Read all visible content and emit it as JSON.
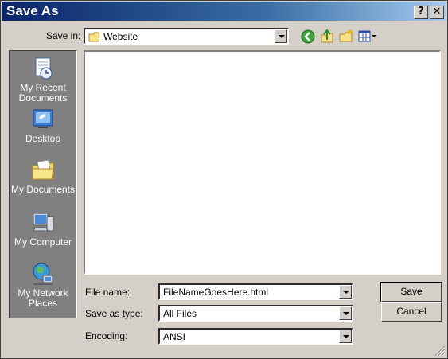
{
  "window": {
    "title": "Save As"
  },
  "titlebar": {
    "help_label": "?",
    "close_label": "✕"
  },
  "save_in": {
    "label": "Save in:",
    "value": "Website"
  },
  "toolbar": {
    "back": "back-icon",
    "up": "up-folder-icon",
    "new_folder": "new-folder-icon",
    "views": "views-menu-icon"
  },
  "places": [
    {
      "label": "My Recent Documents",
      "icon": "recent-documents-icon"
    },
    {
      "label": "Desktop",
      "icon": "desktop-icon"
    },
    {
      "label": "My Documents",
      "icon": "my-documents-icon"
    },
    {
      "label": "My Computer",
      "icon": "my-computer-icon"
    },
    {
      "label": "My Network Places",
      "icon": "network-places-icon"
    }
  ],
  "form": {
    "file_name_label": "File name:",
    "file_name_value": "FileNameGoesHere.html",
    "save_as_type_label": "Save as type:",
    "save_as_type_value": "All Files",
    "encoding_label": "Encoding:",
    "encoding_value": "ANSI"
  },
  "buttons": {
    "save": "Save",
    "cancel": "Cancel"
  }
}
